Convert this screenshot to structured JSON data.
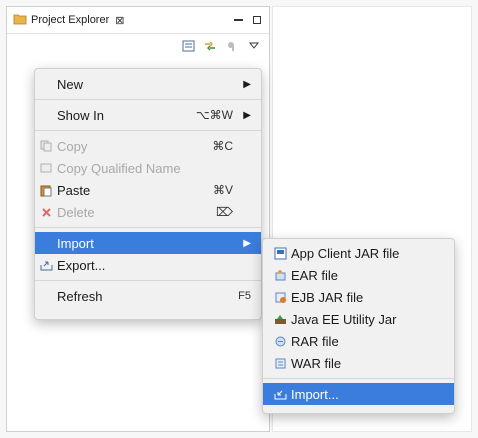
{
  "explorer": {
    "tab_title": "Project Explorer",
    "close_glyph": "⊠",
    "toolbar_icons": [
      "collapse-all-icon",
      "link-with-editor-icon",
      "filter-icon",
      "view-menu-icon"
    ]
  },
  "context_menu": {
    "new_label": "New",
    "show_in_label": "Show In",
    "show_in_shortcut": "⌥⌘W",
    "copy_label": "Copy",
    "copy_shortcut": "⌘C",
    "copy_qualified_label": "Copy Qualified Name",
    "paste_label": "Paste",
    "paste_shortcut": "⌘V",
    "delete_label": "Delete",
    "delete_shortcut": "⌦",
    "import_label": "Import",
    "export_label": "Export...",
    "refresh_label": "Refresh",
    "refresh_shortcut": "F5"
  },
  "import_submenu": {
    "items": [
      "App Client JAR file",
      "EAR file",
      "EJB JAR file",
      "Java EE Utility Jar",
      "RAR file",
      "WAR file"
    ],
    "more_label": "Import..."
  },
  "colors": {
    "selection": "#3b7ddd",
    "menu_bg": "#f1f1f1"
  }
}
